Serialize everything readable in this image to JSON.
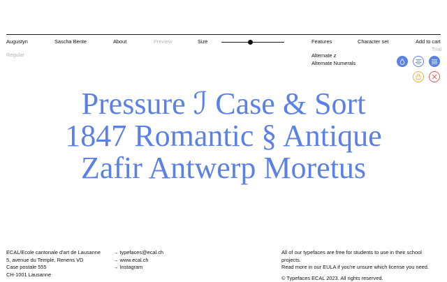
{
  "nav": {
    "augustyn": "Augustyn",
    "sascha_bente": "Sascha Bente",
    "about": "About",
    "preview": "Preview",
    "size": "Size",
    "features": "Features",
    "character_set": "Character set",
    "add_to_cart": "Add to cart",
    "trial": "Trial"
  },
  "style_label": "Regular",
  "size_slider": {
    "value_fraction": 0.46
  },
  "features": {
    "alternate_z": "Alternate z",
    "alternate_numerals": "Alternate Numerals"
  },
  "controls": [
    {
      "name": "ink-drop-icon",
      "active": true
    },
    {
      "name": "align-center-icon",
      "active": false
    },
    {
      "name": "align-justify-icon",
      "active": true
    },
    {
      "name": "shuffle-icon",
      "color": "#f2b134"
    },
    {
      "name": "close-icon",
      "color": "#e55a4a"
    }
  ],
  "specimen": {
    "lines": [
      "Pressure ℐ Case & Sort",
      "1847 Romantic § Antique",
      "Zafir Antwerp Moretus"
    ],
    "color": "#5b80e6"
  },
  "footer": {
    "address": [
      "ECAL/Ecole cantonale d'art de Lausanne",
      "5, avenue du Temple, Renens VD",
      "Case postale 555",
      "CH-1001 Lausanne"
    ],
    "links": [
      "→ typefaces@ecal.ch",
      "→ www.ecal.ch",
      "→ Instagram"
    ],
    "license_note": [
      "All of our typefaces are free for students to use in their school",
      "projects.",
      "Read more in our EULA if you're unsure which license you need."
    ],
    "copyright": "© Typefaces ECAL 2023. All rights reserved."
  },
  "colors": {
    "accent": "#5b80e6",
    "text": "#111111",
    "muted": "#b5b5b5",
    "warning": "#f2b134",
    "danger": "#e55a4a"
  }
}
